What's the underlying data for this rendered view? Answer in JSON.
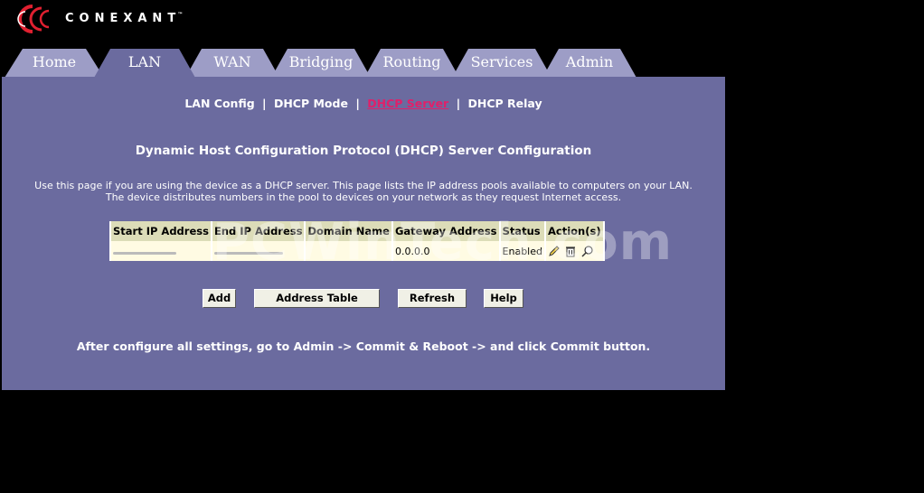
{
  "brand": {
    "name": "CONEXANT",
    "tm": "™",
    "logo_color": "#e02030"
  },
  "tabs": [
    {
      "label": "Home",
      "active": false
    },
    {
      "label": "LAN",
      "active": true
    },
    {
      "label": "WAN",
      "active": false
    },
    {
      "label": "Bridging",
      "active": false
    },
    {
      "label": "Routing",
      "active": false
    },
    {
      "label": "Services",
      "active": false
    },
    {
      "label": "Admin",
      "active": false
    }
  ],
  "subnav": {
    "items": [
      {
        "label": "LAN Config",
        "active": false
      },
      {
        "label": "DHCP Mode",
        "active": false
      },
      {
        "label": "DHCP Server",
        "active": true
      },
      {
        "label": "DHCP Relay",
        "active": false
      }
    ],
    "separator": "|"
  },
  "page": {
    "heading": "Dynamic Host Configuration Protocol (DHCP) Server Configuration",
    "description_line1": "Use this page if you are using the device as a DHCP server. This page lists the IP address pools available to computers on your LAN.",
    "description_line2": "The device distributes numbers in the pool to devices on your network as they request Internet access."
  },
  "table": {
    "headers": [
      "Start IP Address",
      "End IP Address",
      "Domain Name",
      "Gateway Address",
      "Status",
      "Action(s)"
    ],
    "rows": [
      {
        "start_ip": "",
        "end_ip": "",
        "domain": "",
        "gateway": "0.0.0.0",
        "status": "Enabled",
        "actions": [
          "edit-icon",
          "delete-icon",
          "view-icon"
        ]
      }
    ]
  },
  "buttons": {
    "add": "Add",
    "address_table": "Address Table",
    "refresh": "Refresh",
    "help": "Help"
  },
  "footer_note": "After configure all settings, go to Admin -> Commit & Reboot -> and click Commit button.",
  "watermark": "PCWinTech.com",
  "colors": {
    "panel": "#6b6b9f",
    "tab_inactive": "#9d9dc6",
    "tab_active": "#6b6b9f",
    "active_link": "#e0206a",
    "table_header": "#dcdcb8",
    "table_cell": "#fffbe3"
  }
}
